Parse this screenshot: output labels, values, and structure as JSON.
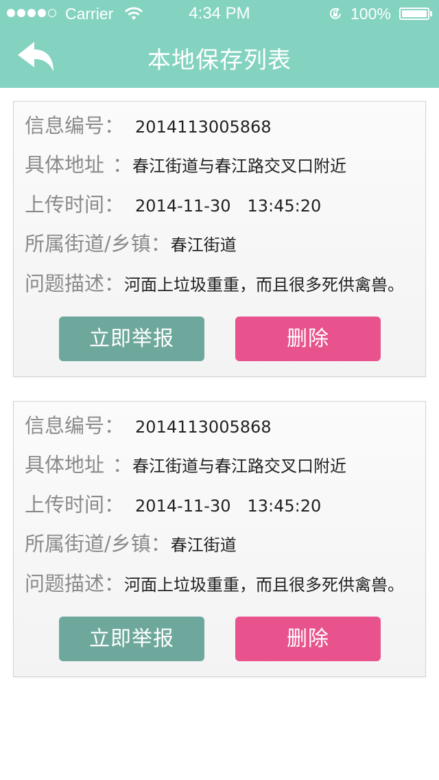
{
  "status_bar": {
    "carrier": "Carrier",
    "time": "4:34 PM",
    "battery": "100%"
  },
  "nav": {
    "title": "本地保存列表",
    "back_icon": "back-arrow-icon"
  },
  "colors": {
    "header": "#84d3c1",
    "report_button": "#6ea89c",
    "delete_button": "#e8538e"
  },
  "records": [
    {
      "id_label": "信息编号",
      "id_sep": "：",
      "id": "2014113005868",
      "address_label": "具体地址",
      "address_sep": "：",
      "address": "春江街道与春江路交叉口附近",
      "time_label": "上传时间",
      "time_sep": "：",
      "time": "2014-11-30　13:45:20",
      "street_label": "所属街道/乡镇",
      "street_sep": "：",
      "street": "春江街道",
      "desc_label": "问题描述",
      "desc_sep": "：",
      "desc": "河面上垃圾重重，而且很多死供禽兽。",
      "report_label": "立即举报",
      "delete_label": "删除"
    },
    {
      "id_label": "信息编号",
      "id_sep": "：",
      "id": "2014113005868",
      "address_label": "具体地址",
      "address_sep": "：",
      "address": "春江街道与春江路交叉口附近",
      "time_label": "上传时间",
      "time_sep": "：",
      "time": "2014-11-30　13:45:20",
      "street_label": "所属街道/乡镇",
      "street_sep": "：",
      "street": "春江街道",
      "desc_label": "问题描述",
      "desc_sep": "：",
      "desc": "河面上垃圾重重，而且很多死供禽兽。",
      "report_label": "立即举报",
      "delete_label": "删除"
    }
  ]
}
